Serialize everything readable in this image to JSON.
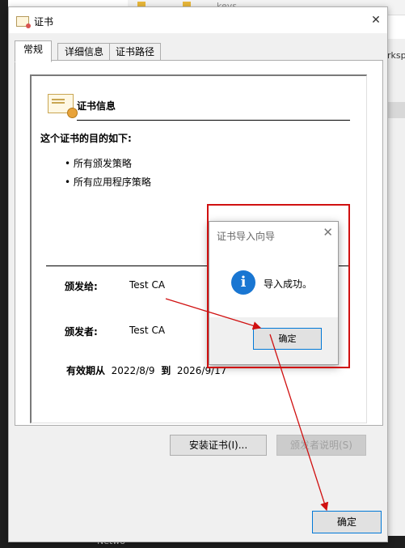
{
  "background": {
    "top_label": "keys",
    "right_label": "rksp",
    "bottom_label": "Netwo"
  },
  "window": {
    "title": "证书",
    "close_glyph": "✕"
  },
  "tabs": [
    {
      "label": "常规"
    },
    {
      "label": "详细信息"
    },
    {
      "label": "证书路径"
    }
  ],
  "general": {
    "info_title": "证书信息",
    "purpose_heading": "这个证书的目的如下:",
    "purposes": [
      "所有颁发策略",
      "所有应用程序策略"
    ],
    "issued_to_label": "颁发给:",
    "issued_to_value": "Test CA",
    "issued_by_label": "颁发者:",
    "issued_by_value": "Test CA",
    "validity_label": "有效期从",
    "valid_from": "2022/8/9",
    "validity_to": "到",
    "valid_to": "2026/9/17"
  },
  "buttons": {
    "install": "安装证书(I)...",
    "issuer_statement": "颁发者说明(S)",
    "ok": "确定"
  },
  "popup": {
    "title": "证书导入向导",
    "close_glyph": "✕",
    "message": "导入成功。",
    "ok": "确定",
    "icon": "info-icon"
  },
  "colors": {
    "annotation_red": "#d01010",
    "info_blue": "#1976d2"
  }
}
